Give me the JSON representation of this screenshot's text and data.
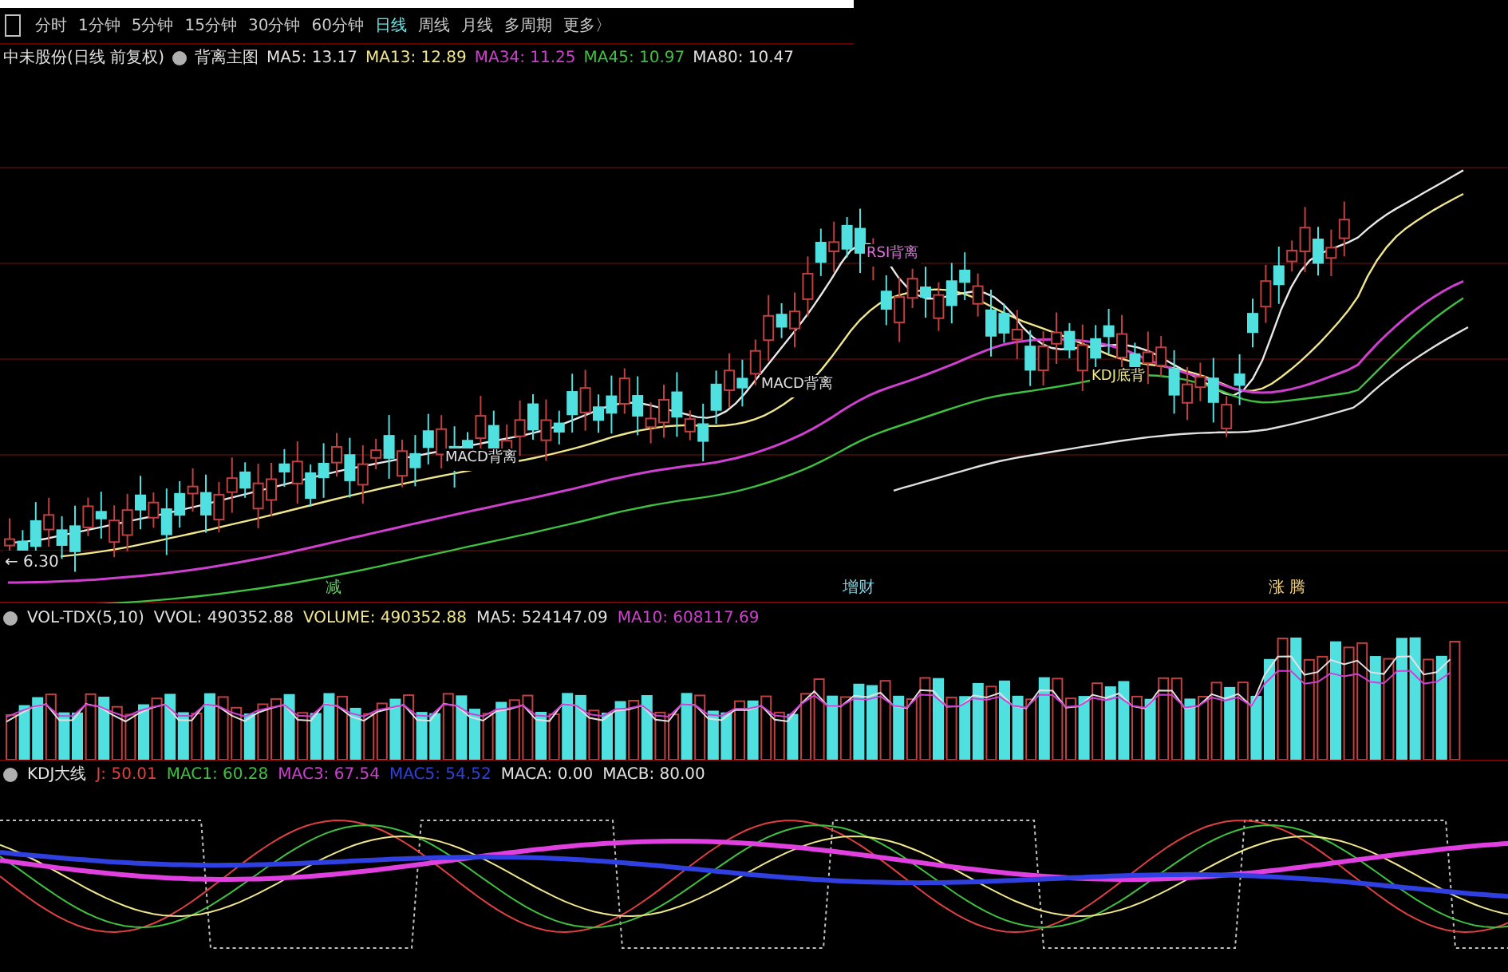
{
  "toolbar": {
    "periods": [
      {
        "label": "分时",
        "selected": false
      },
      {
        "label": "1分钟",
        "selected": false
      },
      {
        "label": "5分钟",
        "selected": false
      },
      {
        "label": "15分钟",
        "selected": false
      },
      {
        "label": "30分钟",
        "selected": false
      },
      {
        "label": "60分钟",
        "selected": false
      },
      {
        "label": "日线",
        "selected": true
      },
      {
        "label": "周线",
        "selected": false
      },
      {
        "label": "月线",
        "selected": false
      },
      {
        "label": "多周期",
        "selected": false
      },
      {
        "label": "更多〉",
        "selected": false
      }
    ]
  },
  "main_header": {
    "title": "中未股份(日线 前复权)",
    "indicator": "背离主图",
    "values": [
      {
        "label": "MA5: 13.17",
        "color": "#e0e0e0"
      },
      {
        "label": "MA13: 12.89",
        "color": "#f0e68c"
      },
      {
        "label": "MA34: 11.25",
        "color": "#d040d0"
      },
      {
        "label": "MA45: 10.97",
        "color": "#40c040"
      },
      {
        "label": "MA80: 10.47",
        "color": "#e0e0e0"
      }
    ]
  },
  "main_chart": {
    "notes": [
      {
        "text": "MACD背离",
        "color": "#e0e0e0"
      },
      {
        "text": "MACD背离",
        "color": "#e0e0e0"
      },
      {
        "text": "RSI背离",
        "color": "#e070e0"
      },
      {
        "text": "KDJ底背",
        "color": "#f0e68c"
      }
    ],
    "low_label": "← 6.30",
    "markers": [
      {
        "text": "减",
        "color": "#60d060"
      },
      {
        "text": "增财",
        "color": "#80d0e0"
      },
      {
        "text": "涨 腾",
        "color": "#f0d080"
      }
    ]
  },
  "volume_header": {
    "name": "VOL-TDX(5,10)",
    "values": [
      {
        "label": "VVOL: 490352.88",
        "color": "#e0e0e0"
      },
      {
        "label": "VOLUME: 490352.88",
        "color": "#f0e68c"
      },
      {
        "label": "MA5: 524147.09",
        "color": "#e0e0e0"
      },
      {
        "label": "MA10: 608117.69",
        "color": "#d040d0"
      }
    ]
  },
  "kdj_header": {
    "name": "KDJ大线",
    "values": [
      {
        "label": "J: 50.01",
        "color": "#e04040"
      },
      {
        "label": "MAC1: 60.28",
        "color": "#40c040"
      },
      {
        "label": "MAC3: 67.54",
        "color": "#d040d0"
      },
      {
        "label": "MAC5: 54.52",
        "color": "#3040e0"
      },
      {
        "label": "MACA: 0.00",
        "color": "#e0e0e0"
      },
      {
        "label": "MACB: 80.00",
        "color": "#e0e0e0"
      }
    ]
  }
}
